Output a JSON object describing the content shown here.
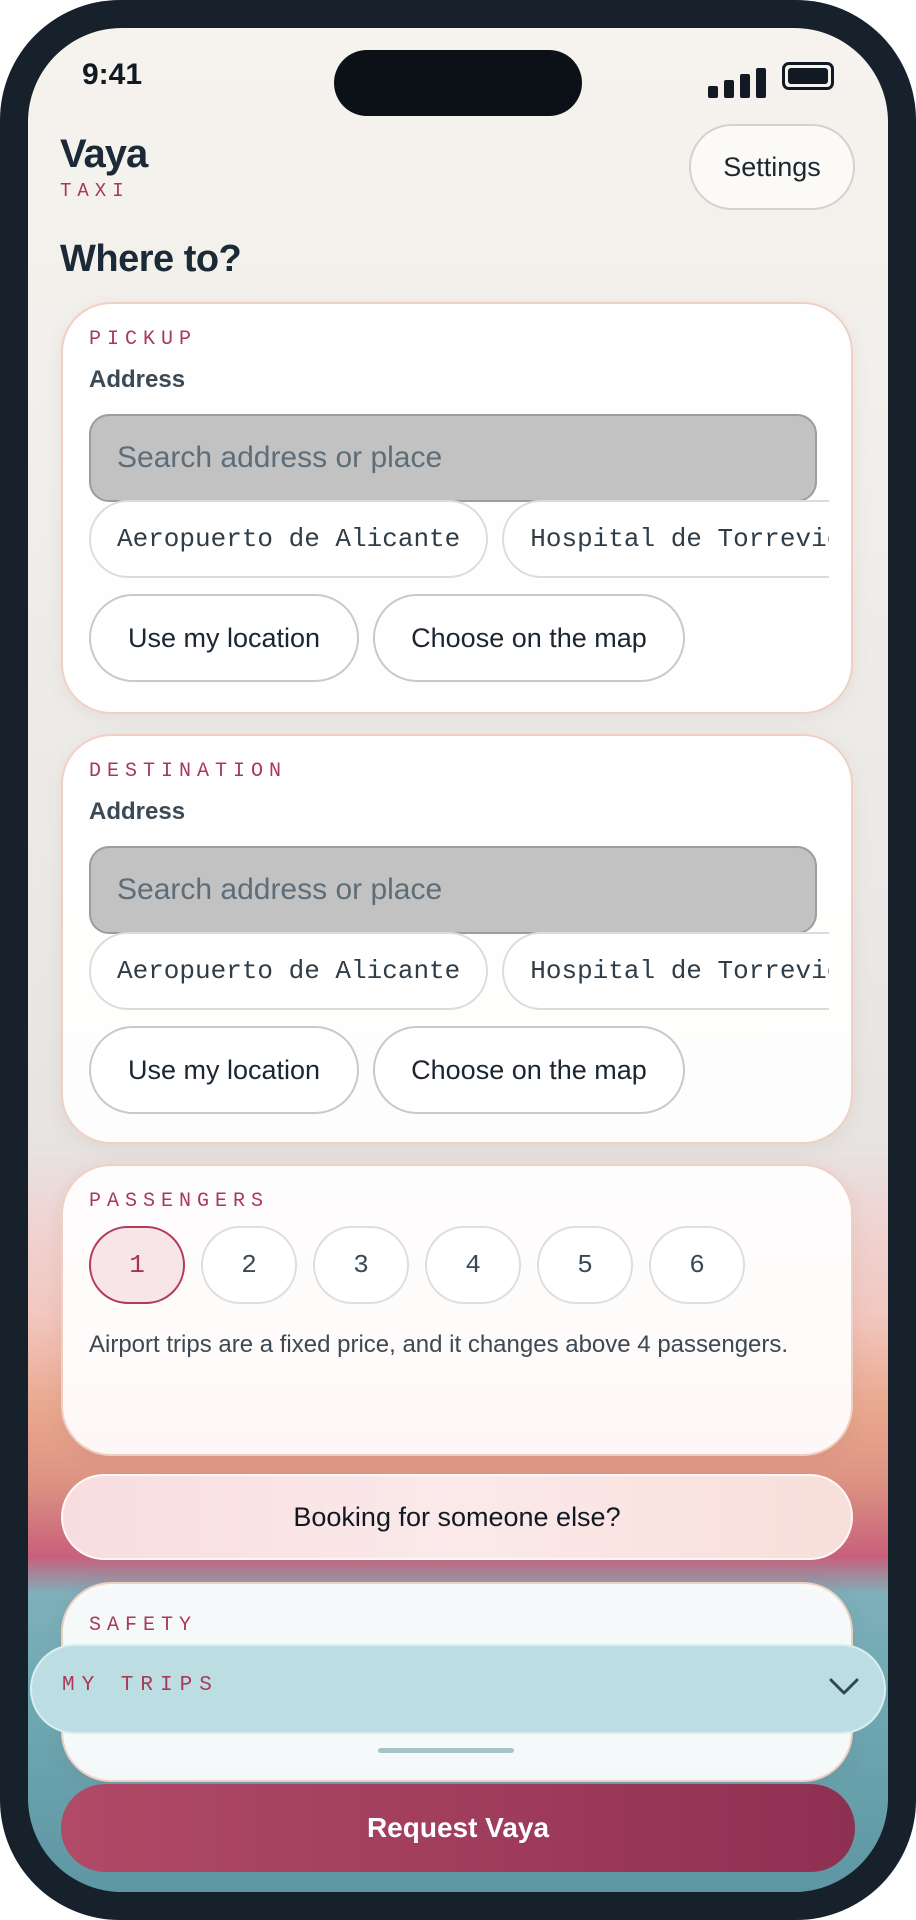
{
  "status_bar": {
    "time": "9:41"
  },
  "app": {
    "name": "Vaya",
    "subtitle": "TAXI"
  },
  "header": {
    "settings_label": "Settings"
  },
  "main": {
    "heading": "Where to?"
  },
  "pickup": {
    "label": "PICKUP",
    "field_label": "Address",
    "placeholder": "Search address or place",
    "suggestions": [
      "Aeropuerto de Alicante",
      "Hospital de Torrevieja"
    ],
    "use_location_label": "Use my location",
    "choose_map_label": "Choose on the map"
  },
  "destination": {
    "label": "DESTINATION",
    "field_label": "Address",
    "placeholder": "Search address or place",
    "suggestions": [
      "Aeropuerto de Alicante",
      "Hospital de Torrevieja"
    ],
    "use_location_label": "Use my location",
    "choose_map_label": "Choose on the map"
  },
  "passengers": {
    "label": "PASSENGERS",
    "options": [
      "1",
      "2",
      "3",
      "4",
      "5",
      "6"
    ],
    "selected": "1",
    "note": "Airport trips are a fixed price, and it changes above 4 passengers."
  },
  "booking_other_label": "Booking for someone else?",
  "safety": {
    "label": "SAFETY"
  },
  "my_trips": {
    "label": "MY TRIPS",
    "icon": "chevron-down-icon"
  },
  "request_label": "Request Vaya",
  "colors": {
    "accent": "#a83a57",
    "primary_button": "#9e3a5b",
    "selected_chip_bg": "#f8e5e8"
  }
}
